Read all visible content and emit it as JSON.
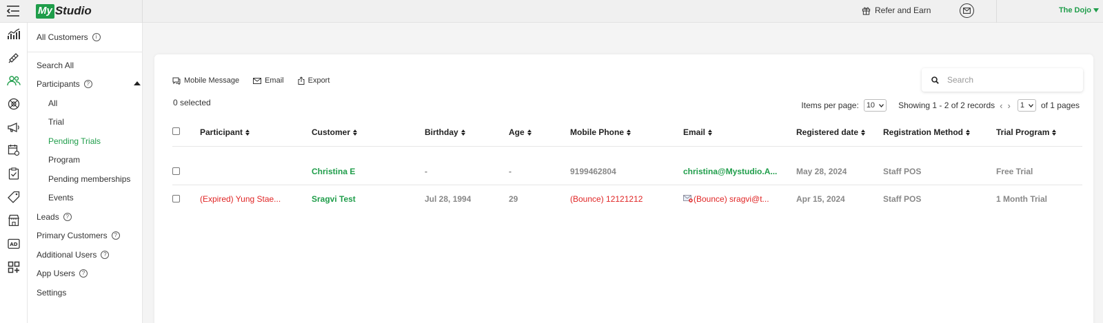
{
  "topbar": {
    "logo_my": "My",
    "logo_studio": "Studio",
    "refer_label": "Refer and Earn",
    "studio_name": "The Dojo"
  },
  "sidebar": {
    "header": "All Customers",
    "items": [
      {
        "label": "Search All"
      },
      {
        "label": "Participants"
      },
      {
        "label": "All"
      },
      {
        "label": "Trial"
      },
      {
        "label": "Pending Trials"
      },
      {
        "label": "Program"
      },
      {
        "label": "Pending memberships"
      },
      {
        "label": "Events"
      },
      {
        "label": "Leads"
      },
      {
        "label": "Primary Customers"
      },
      {
        "label": "Additional Users"
      },
      {
        "label": "App Users"
      },
      {
        "label": "Settings"
      }
    ]
  },
  "toolbar": {
    "mobile_message": "Mobile Message",
    "email": "Email",
    "export": "Export",
    "search_placeholder": "Search"
  },
  "selection": {
    "count_text": "0 selected"
  },
  "pager": {
    "items_per_page_label": "Items per page:",
    "items_per_page": "10",
    "showing": "Showing 1 - 2 of 2 records",
    "page": "1",
    "of_pages": "of 1 pages"
  },
  "table": {
    "columns": [
      "Participant",
      "Customer",
      "Birthday",
      "Age",
      "Mobile Phone",
      "Email",
      "Registered date",
      "Registration Method",
      "Trial Program"
    ],
    "rows": [
      {
        "participant": "",
        "customer": "Christina E",
        "birthday": "-",
        "age": "-",
        "phone": "9199462804",
        "email": "christina@Mystudio.A...",
        "registered": "May 28, 2024",
        "method": "Staff POS",
        "program": "Free Trial"
      },
      {
        "participant": "(Expired) Yung Stae...",
        "customer": "Sragvi Test",
        "birthday": "Jul 28, 1994",
        "age": "29",
        "phone": "(Bounce) 12121212",
        "email": "(Bounce) sragvi@t...",
        "registered": "Apr 15, 2024",
        "method": "Staff POS",
        "program": "1 Month Trial"
      }
    ]
  },
  "colors": {
    "brand_green": "#1f9d4a",
    "alert_red": "#e02424"
  }
}
